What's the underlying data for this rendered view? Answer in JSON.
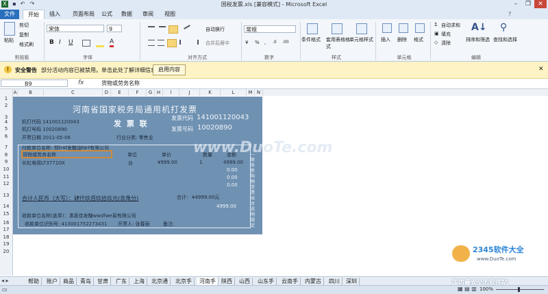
{
  "window": {
    "title": "国税发票.xls [兼容模式] - Microsoft Excel"
  },
  "tabs": {
    "file": "文件",
    "items": [
      "开始",
      "插入",
      "页面布局",
      "公式",
      "数据",
      "审阅",
      "视图"
    ]
  },
  "ribbon": {
    "clipboard": {
      "label": "剪贴板",
      "paste": "粘贴",
      "cut": "剪切",
      "copy": "复制",
      "format_painter": "格式刷"
    },
    "font": {
      "label": "字体",
      "name": "宋体",
      "size": "9",
      "bold": "B",
      "italic": "I",
      "underline": "U"
    },
    "alignment": {
      "label": "对齐方式",
      "wrap": "自动换行",
      "merge": "合并后居中"
    },
    "number": {
      "label": "数字",
      "format": "常规",
      "percent": "%",
      "comma": ","
    },
    "styles": {
      "label": "样式",
      "conditional": "条件格式",
      "table": "套用表格格式",
      "cell": "单元格样式"
    },
    "cells": {
      "label": "单元格",
      "insert": "插入",
      "delete": "删除",
      "format": "格式"
    },
    "editing": {
      "label": "编辑",
      "autosum": "自动求和",
      "fill": "填充",
      "clear": "清除",
      "sort": "排序和筛选",
      "find": "查找和选择"
    }
  },
  "security": {
    "title": "安全警告",
    "message": "部分活动内容已被禁用。单击此处了解详细信息。",
    "button": "启用内容"
  },
  "formula": {
    "cell": "B9",
    "fx": "fx",
    "value": "货物或劳务名称"
  },
  "columns": [
    "A",
    "B",
    "C",
    "D",
    "E",
    "F",
    "G",
    "H",
    "I",
    "J",
    "K",
    "L",
    "M",
    "N"
  ],
  "rows": [
    "1",
    "2",
    "3",
    "4",
    "5",
    "6",
    "7",
    "8",
    "9",
    "10",
    "11",
    "12",
    "13",
    "14",
    "15",
    "16",
    "17",
    "18",
    "19",
    "20"
  ],
  "invoice": {
    "title": "河南省国家税务局通用机打发票",
    "machine_code": "机打代码 141001120043",
    "machine_no": "机打号码 10020890",
    "kind": "发 票 联",
    "invoice_code_label": "发票代码",
    "invoice_code": "141001120043",
    "invoice_no_label": "发票号码",
    "invoice_no": "10020890",
    "date": "开票日期 2011-05-06",
    "industry": "行业分类: 零售业",
    "payer": "付款单位名称: 郑fr4f发糖油fdrf有限公司",
    "col_item": "货物或劳务名称",
    "col_unit": "单位",
    "col_price": "单价",
    "col_qty": "数量",
    "col_amount": "金额",
    "item_name": "长虹电视LT3771OX",
    "item_unit": "台",
    "item_price": "¥999.00",
    "item_qty": "1",
    "item_amount": "4999.00",
    "zero1": "0.00",
    "zero2": "0.00",
    "zero3": "0.00",
    "total_cn": "合计人民币（大写）：肆仟玖佰玖拾玖元(去角分)",
    "total_label": "合计:",
    "total_value": "¥4999.00元",
    "total_small": "4999.00",
    "payee": "收款单位名称(盖章)：漯县佳发糖wwdfwe易有限公司",
    "payee_id": "收款单位识别号: 413001752273431",
    "drawer": "开票人: 张春丽",
    "remark": "备注:",
    "side_text": "—联系新购物货票出台说明规定"
  },
  "sheets": [
    "帮助",
    "账户",
    "商品",
    "青岛",
    "甘肃",
    "广东",
    "上海",
    "北京通",
    "北京手",
    "河南手",
    "陕西",
    "山西",
    "山东手",
    "云南手",
    "内蒙古",
    "四川",
    "深圳"
  ],
  "status": {
    "zoom": "100%"
  },
  "watermarks": {
    "duote": "www.DuoTe.com",
    "site": "2345软件大全",
    "site2": "www.DuoTe.com",
    "footer": "国内最安全的软件站"
  }
}
